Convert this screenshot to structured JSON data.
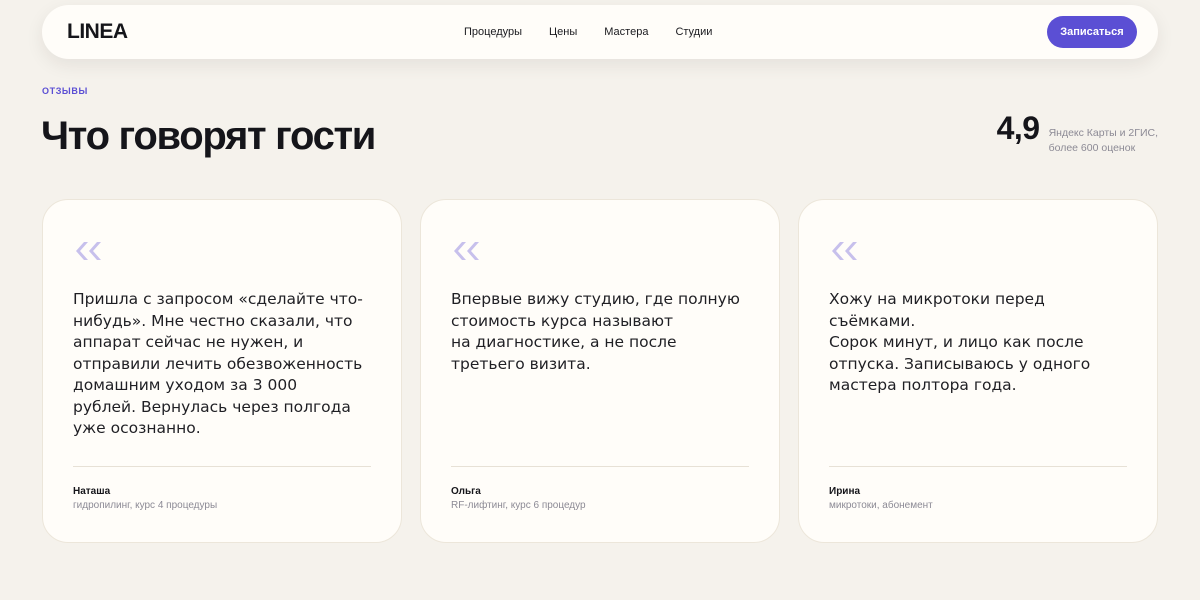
{
  "header": {
    "logo": "LINEA",
    "nav": [
      "Процедуры",
      "Цены",
      "Мастера",
      "Студии"
    ],
    "cta_label": "Записаться"
  },
  "section": {
    "eyebrow": "ОТЗЫВЫ",
    "title": "Что говорят гости",
    "rating": {
      "value": "4,9",
      "caption_line1": "Яндекс Карты и 2ГИС,",
      "caption_line2": "более 600 оценок"
    }
  },
  "reviews": [
    {
      "text": "Пришла с запросом «сделайте что-\nнибудь». Мне честно сказали, что\nаппарат сейчас не нужен, и\nотправили лечить обезвоженность\nдомашним уходом за 3 000\nрублей. Вернулась через полгода\nуже осознанно.",
      "author": "Наташа",
      "course": "гидропилинг, курс 4 процедуры"
    },
    {
      "text": "Впервые вижу студию, где полную\nстоимость курса называют\nна диагностике, а не после\nтретьего визита.",
      "author": "Ольга",
      "course": "RF-лифтинг, курс 6 процедур"
    },
    {
      "text": "Хожу на микротоки перед съёмками.\nСорок минут, и лицо как после\nотпуска. Записываюсь у одного\nмастера полтора года.",
      "author": "Ирина",
      "course": "микротоки, абонемент"
    }
  ],
  "colors": {
    "accent": "#5b4fd4",
    "quote_mark": "#c7c0ec",
    "background": "#f5f2ec",
    "card": "#fffdf9"
  },
  "icons": {
    "quote": "quote-open-icon"
  }
}
